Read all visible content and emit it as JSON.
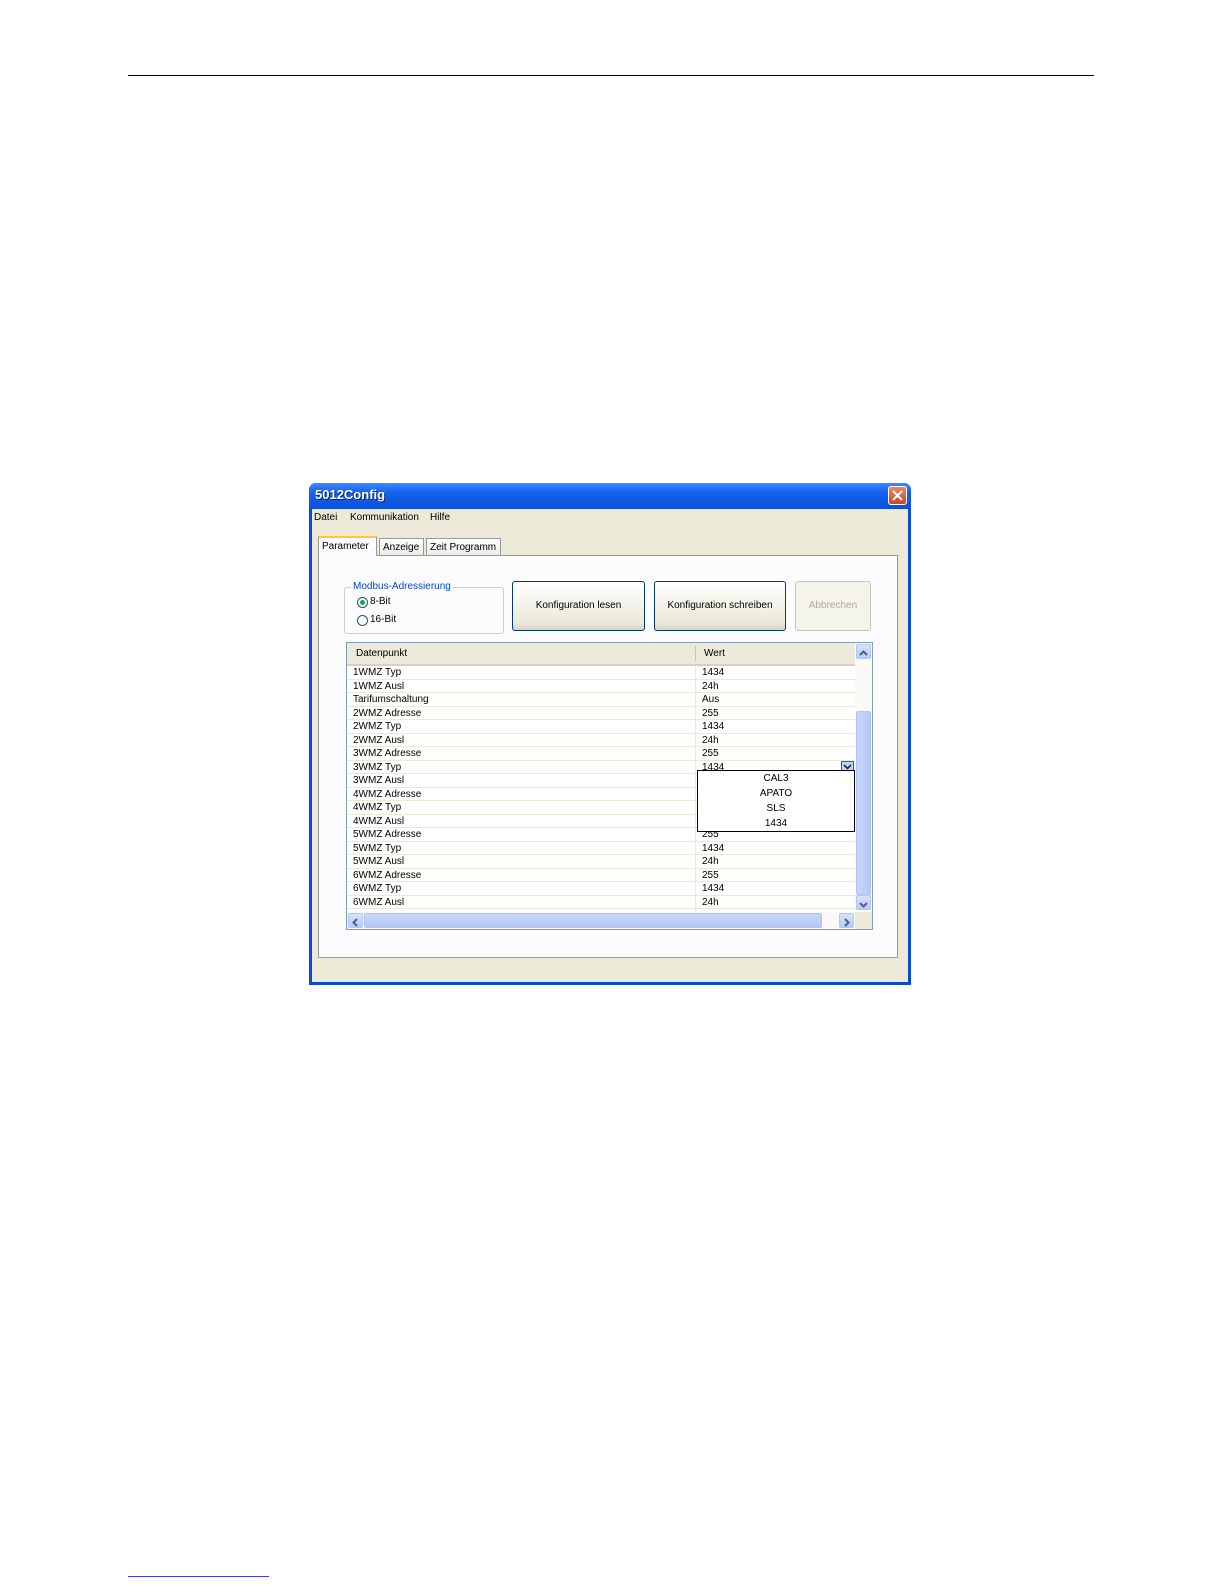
{
  "window": {
    "title": "5012Config"
  },
  "menu": [
    "Datei",
    "Kommunikation",
    "Hilfe"
  ],
  "tabs": [
    "Parameter",
    "Anzeige",
    "Zeit Programm"
  ],
  "modbus": {
    "legend": "Modbus-Adressierung",
    "options": [
      "8-Bit",
      "16-Bit"
    ],
    "selected": "8-Bit"
  },
  "buttons": {
    "read": "Konfiguration lesen",
    "write": "Konfiguration schreiben",
    "cancel": "Abbrechen"
  },
  "grid": {
    "columns": [
      "Datenpunkt",
      "Wert"
    ],
    "rows": [
      {
        "name": "1WMZ Typ",
        "value": "1434"
      },
      {
        "name": "1WMZ Ausl",
        "value": "24h"
      },
      {
        "name": "Tarifumschaltung",
        "value": "Aus"
      },
      {
        "name": "2WMZ Adresse",
        "value": "255"
      },
      {
        "name": "2WMZ Typ",
        "value": "1434"
      },
      {
        "name": "2WMZ Ausl",
        "value": "24h"
      },
      {
        "name": "3WMZ Adresse",
        "value": "255"
      },
      {
        "name": "3WMZ Typ",
        "value": "1434"
      },
      {
        "name": "3WMZ Ausl",
        "value": ""
      },
      {
        "name": "4WMZ Adresse",
        "value": ""
      },
      {
        "name": "4WMZ Typ",
        "value": ""
      },
      {
        "name": "4WMZ Ausl",
        "value": ""
      },
      {
        "name": "5WMZ Adresse",
        "value": "255"
      },
      {
        "name": "5WMZ Typ",
        "value": "1434"
      },
      {
        "name": "5WMZ Ausl",
        "value": "24h"
      },
      {
        "name": "6WMZ Adresse",
        "value": "255"
      },
      {
        "name": "6WMZ Typ",
        "value": "1434"
      },
      {
        "name": "6WMZ Ausl",
        "value": "24h"
      }
    ],
    "dropdown_options": [
      "CAL3",
      "APATO",
      "SLS",
      "1434"
    ]
  }
}
